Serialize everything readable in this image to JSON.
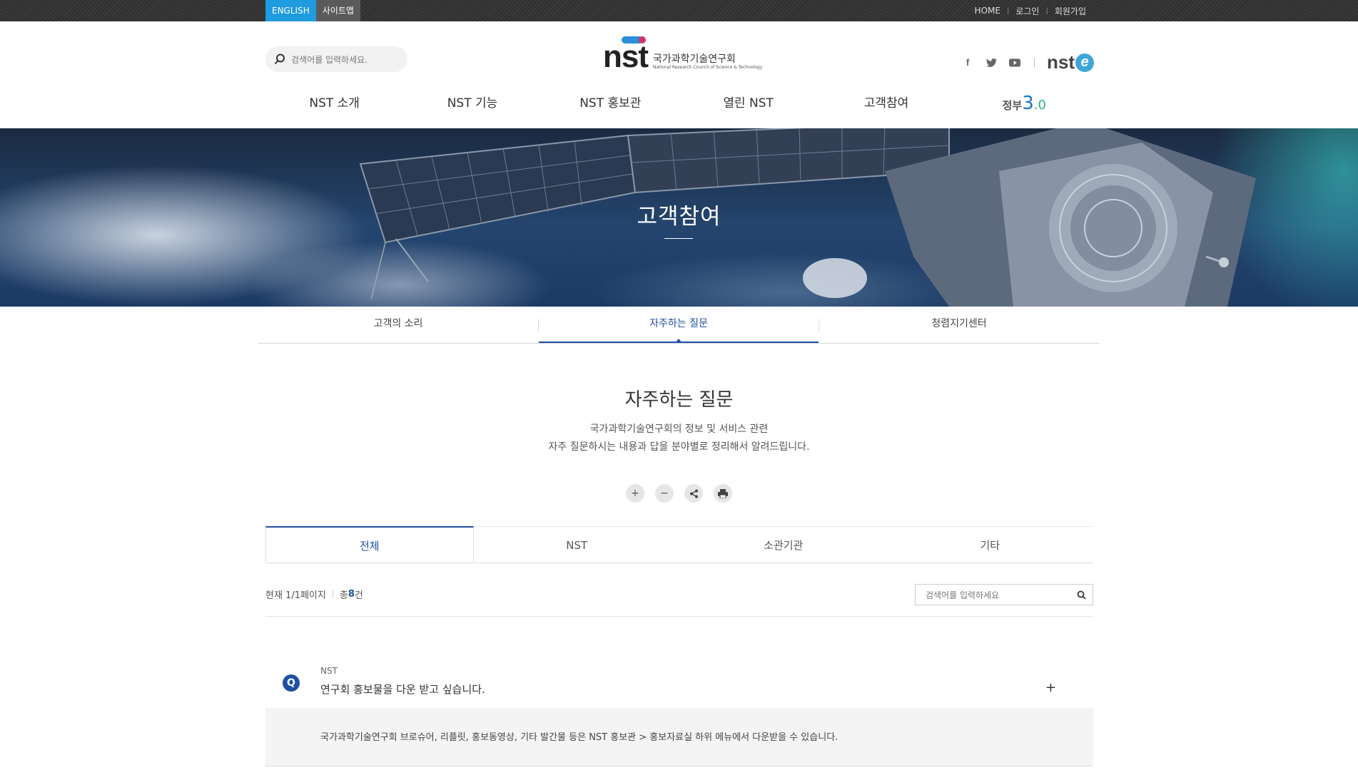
{
  "topbar": {
    "english": "ENGLISH",
    "sitemap": "사이트맵",
    "home": "HOME",
    "login": "로그인",
    "join": "회원가입"
  },
  "header": {
    "search_placeholder": "검색어를 입력하세요.",
    "logo_nst": "nst",
    "logo_kor": "국가과학기술연구회",
    "logo_eng": "National Research Council of Science & Technology",
    "social": [
      "facebook-icon",
      "twitter-icon",
      "youtube-icon"
    ],
    "nste": "nst",
    "nste_e": "e"
  },
  "nav": {
    "items": [
      "NST 소개",
      "NST 기능",
      "NST 홍보관",
      "열린 NST",
      "고객참여"
    ],
    "gov_label": "정부",
    "gov_three": "3",
    "gov_zero": ".0"
  },
  "hero": {
    "title": "고객참여"
  },
  "subtabs": [
    "고객의 소리",
    "자주하는 질문",
    "청렴지기센터"
  ],
  "page": {
    "title": "자주하는 질문",
    "desc_line1": "국가과학기술연구회의 정보 및 서비스 관련",
    "desc_line2": "자주 질문하시는 내용과 답을 분야별로 정리해서 알려드립니다."
  },
  "tools": {
    "zoom_in": "+",
    "zoom_out": "−"
  },
  "cattabs": [
    "전체",
    "NST",
    "소관기관",
    "기타"
  ],
  "list": {
    "page_info": "현재 1/1페이지",
    "total_prefix": "총 ",
    "total_count": "8",
    "total_suffix": "건",
    "search_placeholder": "검색어를 입력하세요"
  },
  "faq": {
    "badge": "Q",
    "category": "NST",
    "question": "연구회 홍보물을 다운 받고 싶습니다.",
    "toggle": "+",
    "answer": "국가과학기술연구회 브로슈어, 리플릿, 홍보동영상, 기타 발간물 등은 NST 홍보관 > 홍보자료실 하위 메뉴에서 다운받을 수 있습니다."
  },
  "colors": {
    "accent": "#1f4fa3",
    "lang_active": "#1f9be0"
  }
}
